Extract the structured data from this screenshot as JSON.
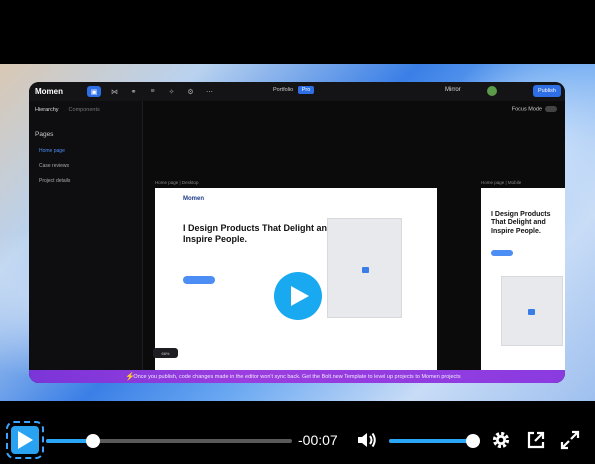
{
  "app": {
    "logo": "Momen",
    "breadcrumb": "Portfolio",
    "breadcrumb_badge": "Pro",
    "mirror_label": "Mirror",
    "publish_label": "Publish"
  },
  "sidebar": {
    "tabs": [
      "Hierarchy",
      "Components"
    ],
    "pages_title": "Pages",
    "items": [
      {
        "label": "Home page",
        "active": true
      },
      {
        "label": "Case reviews",
        "active": false
      },
      {
        "label": "Project details",
        "active": false
      }
    ]
  },
  "canvas": {
    "focus_mode": "Focus Mode",
    "frame1_label": "Home page | Desktop",
    "frame2_label": "Home page | Mobile",
    "desktop_logo": "Momen",
    "desktop_headline": "I Design Products That Delight and Inspire People.",
    "mobile_headline": "I Design Products That Delight and Inspire People.",
    "zoom": "66%"
  },
  "banner": {
    "text": "Once you publish, code changes made in the editor won't sync back. Get the Bolt.new Template to level up projects to Momen projects"
  },
  "player": {
    "time": "-00:07",
    "progress": 0.19,
    "volume": 1.0,
    "accent": "#29a6f5"
  }
}
